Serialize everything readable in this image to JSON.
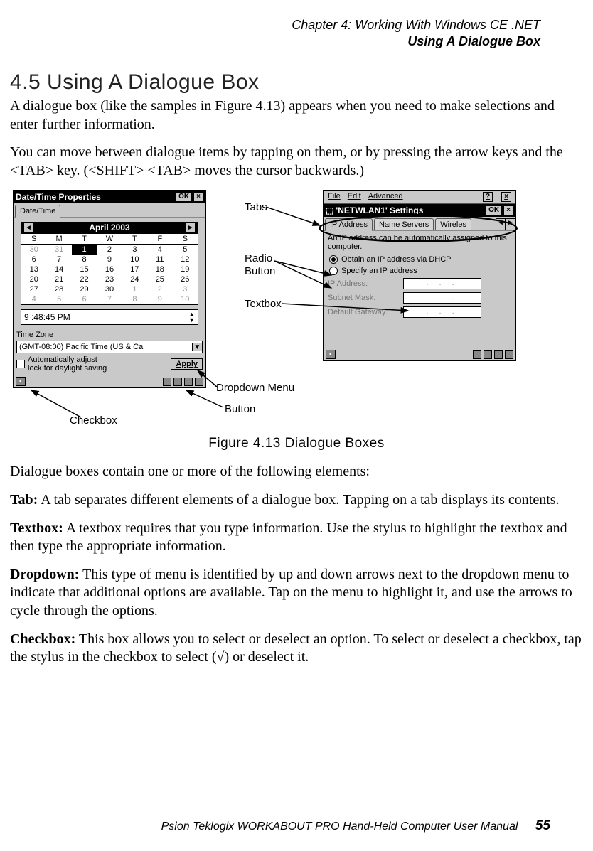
{
  "header": {
    "line1": "Chapter  4:  Working With Windows CE .NET",
    "line2": "Using A Dialogue Box"
  },
  "section": {
    "heading": "4.5   Using A Dialogue Box",
    "para1": "A dialogue box (like the samples in Figure 4.13) appears when you need to make selections and enter further information.",
    "para2": "You can move between dialogue items by tapping on them, or by pressing the arrow keys and the <TAB> key. (<SHIFT> <TAB> moves the cursor backwards.)"
  },
  "figure": {
    "caption": "Figure 4.13 Dialogue Boxes",
    "callouts": {
      "tabs": "Tabs",
      "radio_button_line1": "Radio",
      "radio_button_line2": "Button",
      "textbox": "Textbox",
      "dropdown_menu": "Dropdown Menu",
      "button": "Button",
      "checkbox": "Checkbox"
    },
    "datetime_window": {
      "title": "Date/Time Properties",
      "ok": "OK",
      "close": "×",
      "tab_label": "Date/Time",
      "month": "April 2003",
      "dow": [
        "S",
        "M",
        "T",
        "W",
        "T",
        "F",
        "S"
      ],
      "rows": [
        [
          "30",
          "31",
          "1",
          "2",
          "3",
          "4",
          "5"
        ],
        [
          "6",
          "7",
          "8",
          "9",
          "10",
          "11",
          "12"
        ],
        [
          "13",
          "14",
          "15",
          "16",
          "17",
          "18",
          "19"
        ],
        [
          "20",
          "21",
          "22",
          "23",
          "24",
          "25",
          "26"
        ],
        [
          "27",
          "28",
          "29",
          "30",
          "1",
          "2",
          "3"
        ],
        [
          "4",
          "5",
          "6",
          "7",
          "8",
          "9",
          "10"
        ]
      ],
      "gray_cells": [
        [
          0,
          0
        ],
        [
          0,
          1
        ],
        [
          4,
          4
        ],
        [
          4,
          5
        ],
        [
          4,
          6
        ],
        [
          5,
          0
        ],
        [
          5,
          1
        ],
        [
          5,
          2
        ],
        [
          5,
          3
        ],
        [
          5,
          4
        ],
        [
          5,
          5
        ],
        [
          5,
          6
        ]
      ],
      "selected": [
        0,
        2
      ],
      "time": "9 :48:45 PM",
      "timezone_label": "Time Zone",
      "timezone_value": "(GMT-08:00) Pacific Time (US & Ca",
      "checkbox_text1": "Automatically adjust",
      "checkbox_text2": "lock for daylight saving",
      "apply": "Apply"
    },
    "net_window": {
      "menu": [
        "File",
        "Edit",
        "Advanced"
      ],
      "help": "?",
      "close": "×",
      "title_prefix": "'",
      "title": "NETWLAN1' Settings",
      "ok": "OK",
      "tabs": [
        "IP Address",
        "Name Servers",
        "Wireles"
      ],
      "info": "An IP address can be automatically assigned to this computer.",
      "radio1": "Obtain an IP address via DHCP",
      "radio2": "Specify an IP address",
      "fields": {
        "ip": "IP Address:",
        "subnet": "Subnet Mask:",
        "gateway": "Default Gateway:"
      },
      "ip_placeholder": ".   .   ."
    }
  },
  "body_after": {
    "intro": "Dialogue boxes contain one or more of the following elements:",
    "tab": {
      "term": "Tab:",
      "text": " A tab separates different elements of a dialogue box. Tapping on a tab displays its contents."
    },
    "textbox": {
      "term": "Textbox:",
      "text": " A textbox requires that you type information. Use the stylus to highlight the textbox and then type the appropriate information."
    },
    "dropdown": {
      "term": "Dropdown:",
      "text": " This type of menu is identified by up and down arrows next to the dropdown menu to indicate that additional options are available. Tap on the menu to highlight it, and use the arrows to cycle through the options."
    },
    "checkbox": {
      "term": "Checkbox:",
      "text": " This box allows you to select or deselect an option. To select or deselect a checkbox, tap the stylus in the checkbox to select (√) or deselect it."
    }
  },
  "footer": {
    "text": "Psion Teklogix WORKABOUT PRO Hand-Held Computer User Manual",
    "page": "55"
  }
}
